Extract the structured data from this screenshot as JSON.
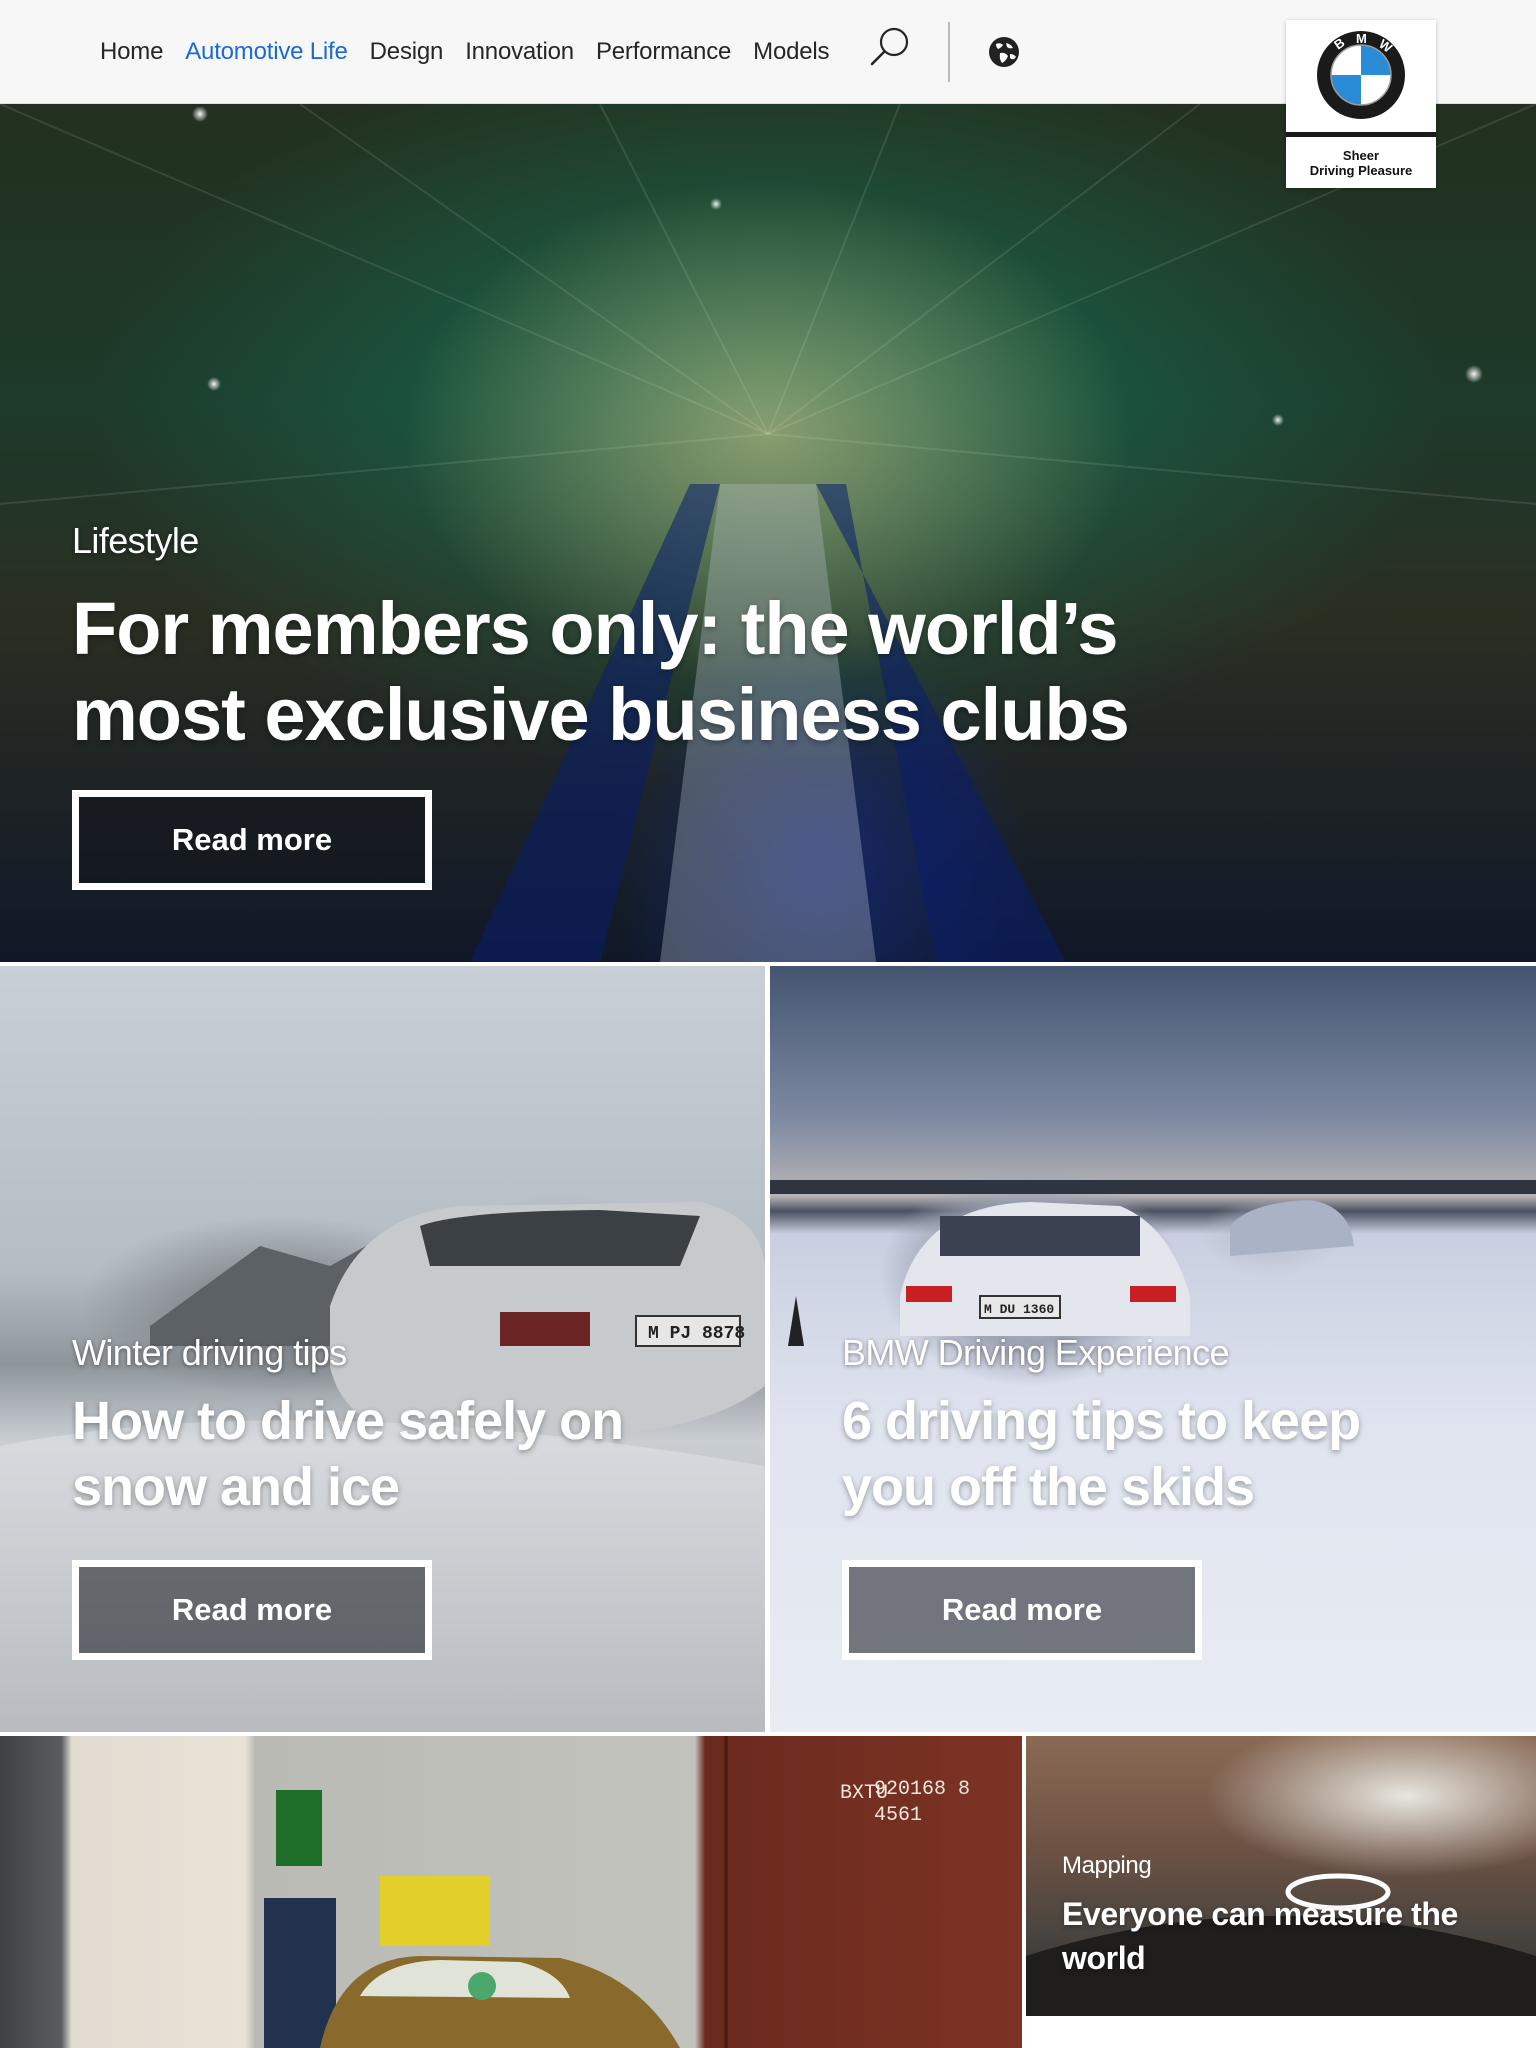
{
  "nav": {
    "items": [
      {
        "label": "Home",
        "active": false
      },
      {
        "label": "Automotive Life",
        "active": true
      },
      {
        "label": "Design",
        "active": false
      },
      {
        "label": "Innovation",
        "active": false
      },
      {
        "label": "Performance",
        "active": false
      },
      {
        "label": "Models",
        "active": false
      }
    ],
    "search_icon": "search-icon",
    "globe_icon": "globe-icon",
    "active_color": "#1c69d4"
  },
  "logo": {
    "letters": "BMW",
    "tagline_line1": "Sheer",
    "tagline_line2": "Driving Pleasure"
  },
  "hero": {
    "category": "Lifestyle",
    "headline_line1": "For members only: the world’s",
    "headline_line2": "most exclusive business clubs",
    "button_label": "Read more"
  },
  "cards": [
    {
      "category": "Winter driving tips",
      "headline_line1": "How to drive safely on",
      "headline_line2": "snow and ice",
      "button_label": "Read more",
      "plate": "M PJ 8878"
    },
    {
      "category": "BMW Driving Experience",
      "headline_line1": "6 driving tips to keep",
      "headline_line2": "you off the skids",
      "button_label": "Read more",
      "plate": "M DU 1360"
    }
  ],
  "bottom": {
    "container_code_1": "BXTU",
    "container_code_2": "920168 8",
    "container_code_3": "4561",
    "mapping": {
      "category": "Mapping",
      "headline_line1": "Everyone can measure the",
      "headline_line2": "world"
    }
  }
}
